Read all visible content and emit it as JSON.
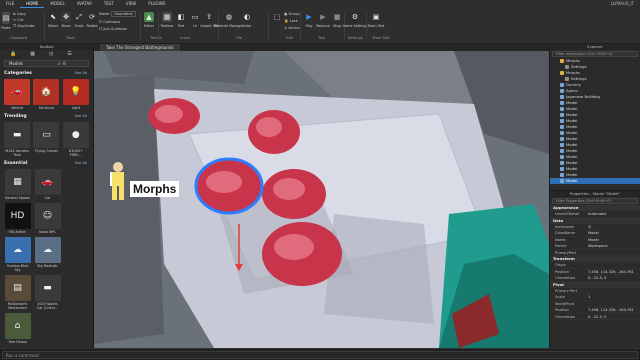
{
  "menu": {
    "tabs": [
      "FILE",
      "HOME",
      "MODEL",
      "AVATAR",
      "TEST",
      "VIEW",
      "PLUGINS"
    ],
    "active": "HOME",
    "user": "LLPRAUS_IT"
  },
  "ribbon": {
    "clipboard": {
      "copy": "Copy",
      "cut": "Cut",
      "duplicate": "Duplicate",
      "paste": "Paste",
      "group": "Clipboard"
    },
    "tools": {
      "select": "Select",
      "move": "Move",
      "scale": "Scale",
      "rotate": "Rotate",
      "group": "Tools"
    },
    "mode": {
      "label": "Mode:",
      "value": "Geometric",
      "collisions": "Collisions",
      "join_surfaces": "Join Surfaces"
    },
    "terrain": {
      "editor": "Editor",
      "toolbox": "Toolbox",
      "group": "Terrain"
    },
    "insert": {
      "part": "Part",
      "ui": "UI",
      "import_3d": "Import 3D",
      "group": "Insert"
    },
    "file": {
      "material_manager": "Material Manager",
      "color": "Color",
      "group": "File"
    },
    "edit": {
      "group": "Edit",
      "group_btn": "Group",
      "lock": "Lock",
      "anchor": "Anchor"
    },
    "test": {
      "play": "Play",
      "resume": "Resume",
      "stop": "Stop",
      "group": "Test"
    },
    "settings": {
      "game_settings": "Game Settings",
      "group": "Settings"
    },
    "team_test": {
      "label": "Team Test",
      "group": "Team Test"
    }
  },
  "toolbox": {
    "title": "Toolbox",
    "category": "Models",
    "sections": [
      {
        "title": "Categories",
        "see_all": "See All",
        "items": [
          {
            "label": "Vehicle",
            "icon": "car-icon",
            "color": "#c0392b"
          },
          {
            "label": "Structure",
            "icon": "building-icon",
            "color": "#b03024"
          },
          {
            "label": "Light",
            "icon": "lamp-icon",
            "color": "#b32a23"
          }
        ]
      },
      {
        "title": "Trending",
        "see_all": "See All",
        "items": [
          {
            "label": "M1A2 Abrams Tank",
            "icon": "tank-icon",
            "color": "#3a3a3a"
          },
          {
            "label": "Flying Carpet",
            "icon": "carpet-icon",
            "color": "#3a3a3a"
          },
          {
            "label": "D1000+ FIREI...",
            "icon": "sphere-icon",
            "color": "#3a3a3a"
          }
        ]
      },
      {
        "title": "Essential",
        "see_all": "See All",
        "items": [
          {
            "label": "Neutral Spawn",
            "icon": "spawn-icon",
            "color": "#3a3a3a"
          },
          {
            "label": "Car",
            "icon": "car-icon",
            "color": "#3a3a3a"
          },
          {
            "label": "HD Admin",
            "icon": "hd-icon",
            "color": "#111111"
          },
          {
            "label": "Noob NPC",
            "icon": "npc-icon",
            "color": "#3a3a3a"
          },
          {
            "label": "Sunless Blue Sky",
            "icon": "sky-icon",
            "color": "#3a6fb0"
          },
          {
            "label": "Sky Realistic",
            "icon": "sky-icon",
            "color": "#5a6f85"
          },
          {
            "label": "McDonald's Restaurant",
            "icon": "restaurant-icon",
            "color": "#5a4a3a"
          },
          {
            "label": "2020 Sports Car (Chevr...",
            "icon": "sports-car-icon",
            "color": "#3a3a3a"
          },
          {
            "label": "Tree House",
            "icon": "treehouse-icon",
            "color": "#4a5a3a"
          }
        ]
      }
    ]
  },
  "viewport": {
    "tab_label": "Take The Strongest Battlegrounds",
    "character_label": "Morphs"
  },
  "explorer": {
    "title": "Explorer",
    "filter_placeholder": "Filter workspace (Ctrl+Shift+X)",
    "rows": [
      {
        "label": "Morphs",
        "indent": 2,
        "color": "#e3b34a"
      },
      {
        "label": "Settings",
        "indent": 3,
        "color": "#8e8e8e"
      },
      {
        "label": "Morphs",
        "indent": 2,
        "color": "#e3b34a"
      },
      {
        "label": "Settings",
        "indent": 3,
        "color": "#8e8e8e"
      },
      {
        "label": "Dummy",
        "indent": 2,
        "color": "#7aa7d8"
      },
      {
        "label": "Apeco",
        "indent": 2,
        "color": "#7aa7d8"
      },
      {
        "label": "Japanese Building",
        "indent": 2,
        "color": "#7aa7d8"
      },
      {
        "label": "Model",
        "indent": 2,
        "color": "#7aa7d8"
      },
      {
        "label": "Model",
        "indent": 2,
        "color": "#7aa7d8"
      },
      {
        "label": "Model",
        "indent": 2,
        "color": "#7aa7d8"
      },
      {
        "label": "Model",
        "indent": 2,
        "color": "#7aa7d8"
      },
      {
        "label": "Model",
        "indent": 2,
        "color": "#7aa7d8"
      },
      {
        "label": "Model",
        "indent": 2,
        "color": "#7aa7d8"
      },
      {
        "label": "Model",
        "indent": 2,
        "color": "#7aa7d8"
      },
      {
        "label": "Model",
        "indent": 2,
        "color": "#7aa7d8"
      },
      {
        "label": "Model",
        "indent": 2,
        "color": "#7aa7d8"
      },
      {
        "label": "Model",
        "indent": 2,
        "color": "#7aa7d8"
      },
      {
        "label": "Model",
        "indent": 2,
        "color": "#7aa7d8"
      },
      {
        "label": "Model",
        "indent": 2,
        "color": "#7aa7d8"
      },
      {
        "label": "Model",
        "indent": 2,
        "color": "#7aa7d8"
      },
      {
        "label": "Model",
        "indent": 2,
        "color": "#7aa7d8",
        "selected": true
      }
    ]
  },
  "properties": {
    "title": "Properties - Model \"Model\"",
    "filter_placeholder": "Filter Properties (Ctrl+Shift+P)",
    "categories": [
      {
        "name": "Appearance",
        "rows": [
          {
            "k": "LevelOfDetail",
            "v": "Automatic"
          }
        ]
      },
      {
        "name": "Data",
        "rows": [
          {
            "k": "Archivable",
            "v": "☑"
          },
          {
            "k": "ClassName",
            "v": "Model"
          },
          {
            "k": "Name",
            "v": "Model"
          },
          {
            "k": "Parent",
            "v": "Workspace"
          },
          {
            "k": "PrimaryPart",
            "v": ""
          }
        ]
      },
      {
        "name": "Transform",
        "rows": [
          {
            "k": "Origin",
            "v": ""
          },
          {
            "k": "Position",
            "v": "7.456, 114.326, -164.761"
          },
          {
            "k": "Orientation",
            "v": "0, -22.5, 0"
          }
        ]
      },
      {
        "name": "Pivot",
        "rows": [
          {
            "k": "Primary Part",
            "v": ""
          },
          {
            "k": "Scale",
            "v": "1"
          },
          {
            "k": "WorldPivot",
            "v": ""
          },
          {
            "k": "Position",
            "v": "7.456, 114.326, -164.761"
          },
          {
            "k": "Orientation",
            "v": "0, -22.5, 0"
          }
        ]
      }
    ]
  },
  "command_bar": {
    "placeholder": "Run a command"
  },
  "colors": {
    "accent": "#3b8fe6",
    "selection": "#2f6fb6",
    "tree_red": "#c8344a",
    "selected_outline": "#2f7dff"
  }
}
